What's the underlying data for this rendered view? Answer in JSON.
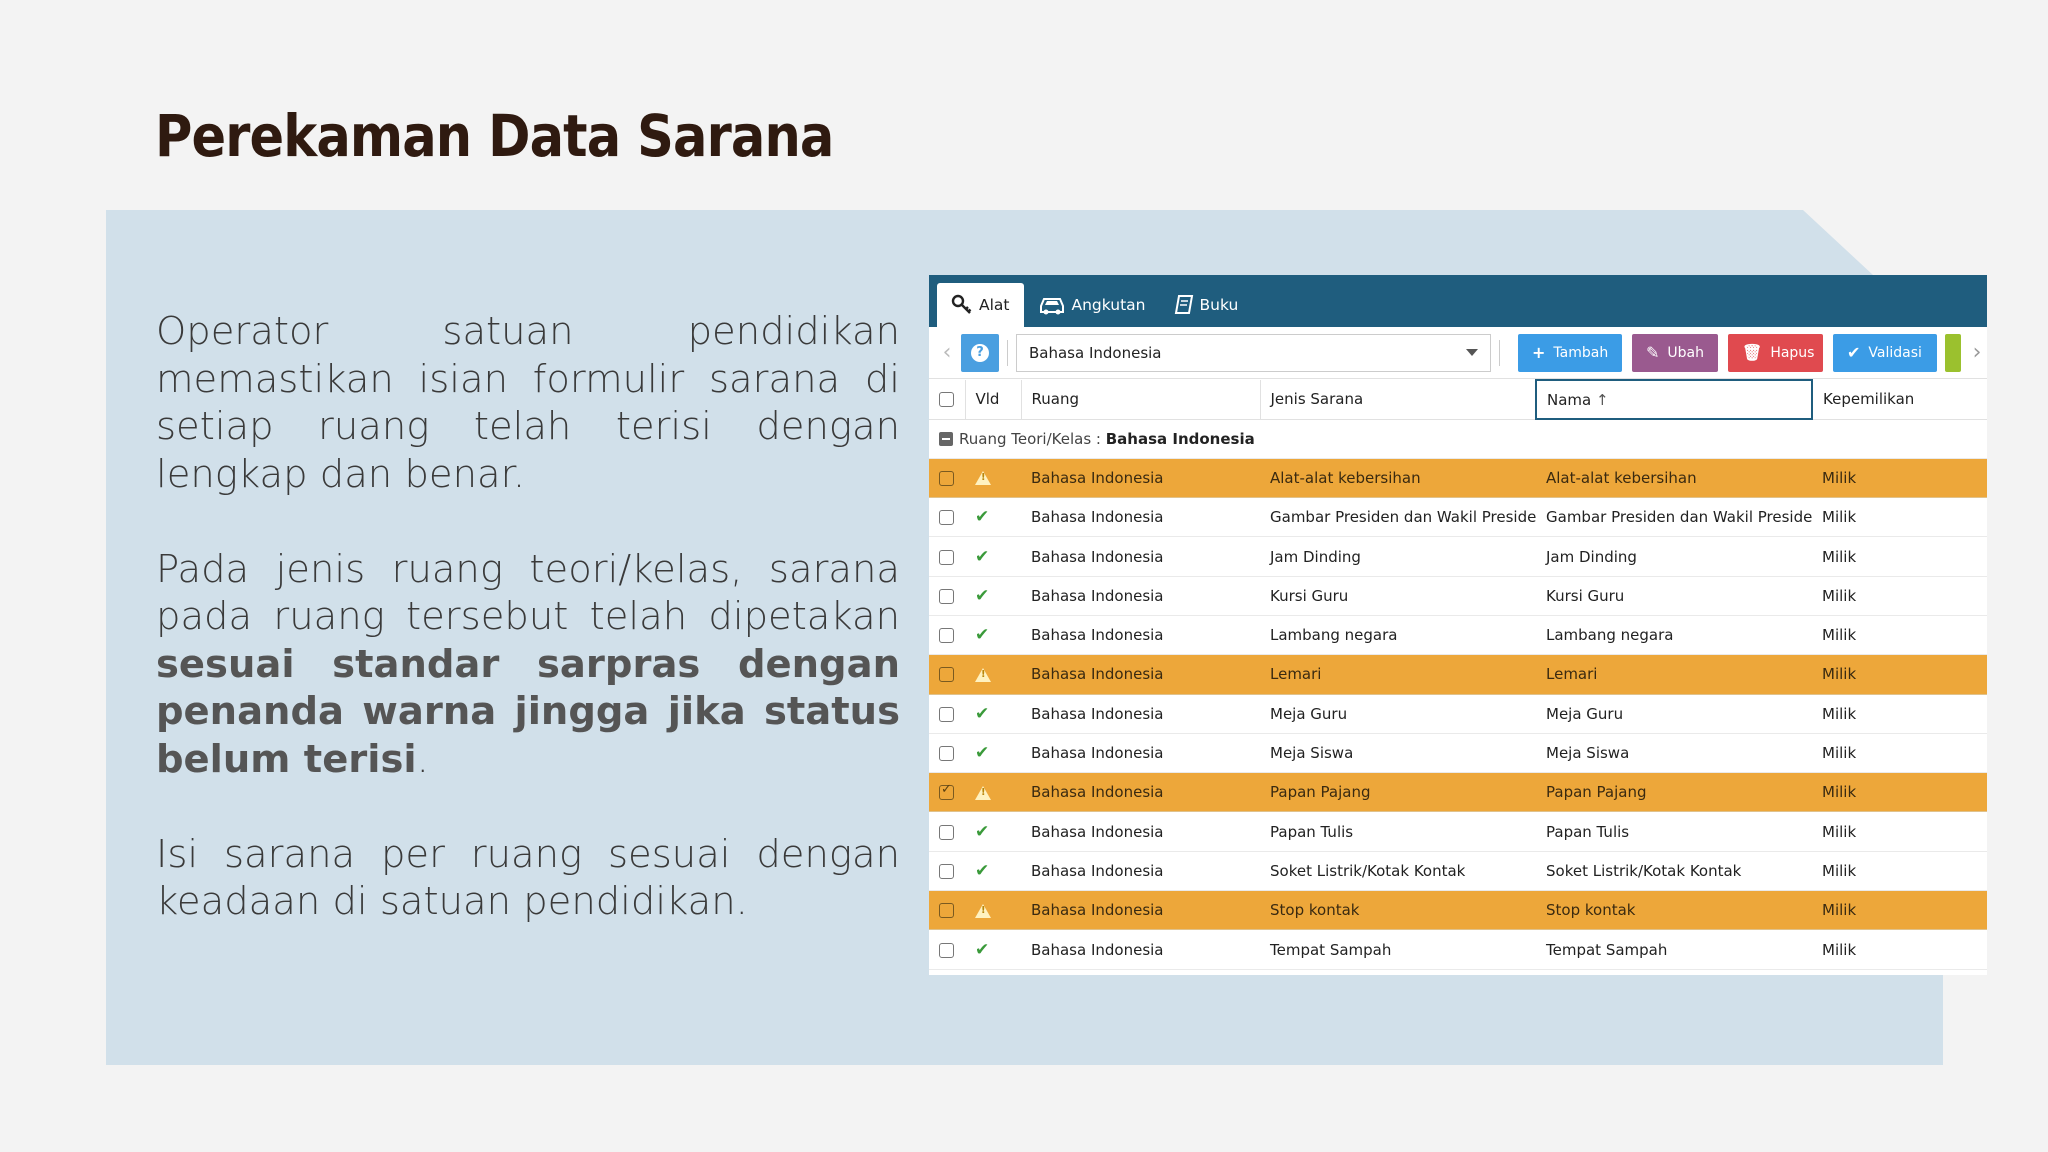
{
  "slide": {
    "title": "Perekaman Data Sarana",
    "para1": "Operator satuan pendidikan memastikan isian formulir sarana di setiap ruang telah terisi dengan lengkap dan benar.",
    "para2_plain": "Pada jenis ruang teori/kelas, sarana pada ruang tersebut telah dipetakan ",
    "para2_bold": "sesuai standar sarpras dengan penanda warna jingga jika status belum terisi",
    "para2_end": ".",
    "para3": "Isi sarana per ruang sesuai dengan keadaan di satuan pendidikan."
  },
  "app": {
    "tabs": [
      {
        "label": "Alat",
        "icon": "key-wrench-icon",
        "active": true
      },
      {
        "label": "Angkutan",
        "icon": "car-icon",
        "active": false
      },
      {
        "label": "Buku",
        "icon": "book-icon",
        "active": false
      }
    ],
    "toolbar": {
      "help": "?",
      "room_select": "Bahasa Indonesia",
      "add_label": "Tambah",
      "edit_label": "Ubah",
      "delete_label": "Hapus",
      "validate_label": "Validasi"
    },
    "columns": {
      "vld": "Vld",
      "ruang": "Ruang",
      "jenis": "Jenis Sarana",
      "nama": "Nama",
      "kepemilikan": "Kepemilikan"
    },
    "group": {
      "label": "Ruang Teori/Kelas : ",
      "value": "Bahasa Indonesia"
    },
    "rows": [
      {
        "status": "warn",
        "ruang": "Bahasa Indonesia",
        "jenis": "Alat-alat kebersihan",
        "nama": "Alat-alat kebersihan",
        "milik": "Milik"
      },
      {
        "status": "ok",
        "ruang": "Bahasa Indonesia",
        "jenis": "Gambar Presiden dan Wakil Presiden",
        "nama": "Gambar Presiden dan Wakil Presiden",
        "milik": "Milik"
      },
      {
        "status": "ok",
        "ruang": "Bahasa Indonesia",
        "jenis": "Jam Dinding",
        "nama": "Jam Dinding",
        "milik": "Milik"
      },
      {
        "status": "ok",
        "ruang": "Bahasa Indonesia",
        "jenis": "Kursi Guru",
        "nama": "Kursi Guru",
        "milik": "Milik"
      },
      {
        "status": "ok",
        "ruang": "Bahasa Indonesia",
        "jenis": "Lambang negara",
        "nama": "Lambang negara",
        "milik": "Milik"
      },
      {
        "status": "warn",
        "ruang": "Bahasa Indonesia",
        "jenis": "Lemari",
        "nama": "Lemari",
        "milik": "Milik"
      },
      {
        "status": "ok",
        "ruang": "Bahasa Indonesia",
        "jenis": "Meja Guru",
        "nama": "Meja Guru",
        "milik": "Milik"
      },
      {
        "status": "ok",
        "ruang": "Bahasa Indonesia",
        "jenis": "Meja Siswa",
        "nama": "Meja Siswa",
        "milik": "Milik"
      },
      {
        "status": "warn",
        "checked": true,
        "ruang": "Bahasa Indonesia",
        "jenis": "Papan Pajang",
        "nama": "Papan Pajang",
        "milik": "Milik"
      },
      {
        "status": "ok",
        "ruang": "Bahasa Indonesia",
        "jenis": "Papan Tulis",
        "nama": "Papan Tulis",
        "milik": "Milik"
      },
      {
        "status": "ok",
        "ruang": "Bahasa Indonesia",
        "jenis": "Soket Listrik/Kotak Kontak",
        "nama": "Soket Listrik/Kotak Kontak",
        "milik": "Milik"
      },
      {
        "status": "warn",
        "ruang": "Bahasa Indonesia",
        "jenis": "Stop kontak",
        "nama": "Stop kontak",
        "milik": "Milik"
      },
      {
        "status": "ok",
        "ruang": "Bahasa Indonesia",
        "jenis": "Tempat Sampah",
        "nama": "Tempat Sampah",
        "milik": "Milik"
      }
    ]
  },
  "colors": {
    "header_bar": "#1f5d7e",
    "warn_row": "#eda73a",
    "panel_bg": "#d1e0ea",
    "title": "#2f1a10"
  }
}
